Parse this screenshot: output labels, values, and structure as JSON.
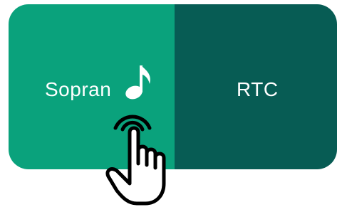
{
  "toggle": {
    "options": [
      {
        "label": "Sopran",
        "active": true
      },
      {
        "label": "RTC",
        "active": false
      }
    ]
  },
  "icons": {
    "note": "music-note-icon",
    "pointer": "hand-pointer-icon"
  },
  "colors": {
    "active_bg": "#0aa27c",
    "inactive_bg": "#075c54",
    "text": "#ffffff"
  }
}
